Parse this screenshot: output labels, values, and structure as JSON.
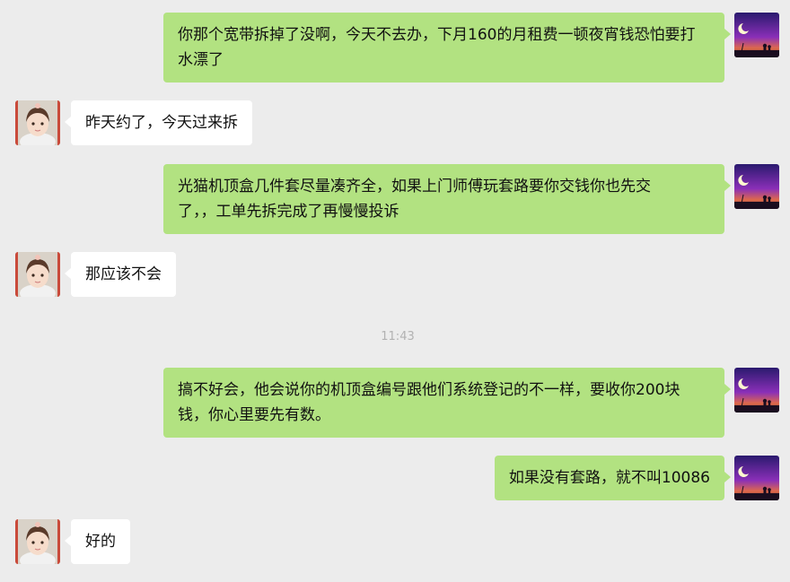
{
  "colors": {
    "background": "#ececec",
    "outgoing_bubble": "#b2e281",
    "incoming_bubble": "#ffffff",
    "timestamp_text": "#b2b2b2"
  },
  "avatars": {
    "self": "night-sky-avatar-icon",
    "contact": "girl-photo-avatar-icon"
  },
  "messages": [
    {
      "sender": "self",
      "text": "你那个宽带拆掉了没啊，今天不去办，下月160的月租费一顿夜宵钱恐怕要打水漂了"
    },
    {
      "sender": "contact",
      "text": "昨天约了，今天过来拆"
    },
    {
      "sender": "self",
      "text": "光猫机顶盒几件套尽量凑齐全，如果上门师傅玩套路要你交钱你也先交了，，工单先拆完成了再慢慢投诉"
    },
    {
      "sender": "contact",
      "text": "那应该不会"
    },
    {
      "type": "time",
      "text": "11:43"
    },
    {
      "sender": "self",
      "text": "搞不好会，他会说你的机顶盒编号跟他们系统登记的不一样，要收你200块钱，你心里要先有数。"
    },
    {
      "sender": "self",
      "text": "如果没有套路，就不叫10086"
    },
    {
      "sender": "contact",
      "text": "好的"
    }
  ]
}
